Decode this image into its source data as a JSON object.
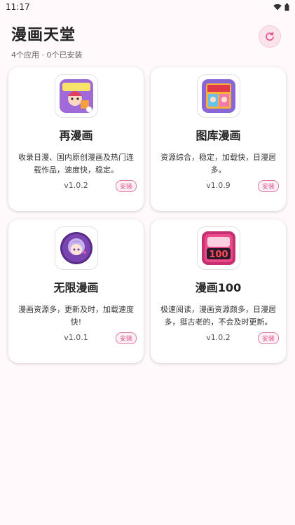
{
  "status": {
    "time": "11:17"
  },
  "header": {
    "title": "漫画天堂",
    "subtitle": "4个应用 · 0个已安装",
    "refresh_icon": "refresh-icon"
  },
  "apps": [
    {
      "name": "再漫画",
      "desc": "收录日漫、国内原创漫画及热门连载作品，速度快，稳定。",
      "version": "v1.0.2",
      "install": "安装",
      "accent": "#a06ad8"
    },
    {
      "name": "图库漫画",
      "desc": "资源综合，稳定，加载快，日漫居多。",
      "version": "v1.0.9",
      "install": "安装",
      "accent": "#8a66d6"
    },
    {
      "name": "无限漫画",
      "desc": "漫画资源多，更新及时，加载速度快!",
      "version": "v1.0.1",
      "install": "安装",
      "accent": "#5a2c8a"
    },
    {
      "name": "漫画100",
      "desc": "极速阅读，漫画资源颇多，日漫居多，挺古老的，不会及时更新。",
      "version": "v1.0.2",
      "install": "安装",
      "accent": "#c63070",
      "icon_text": "100"
    }
  ]
}
